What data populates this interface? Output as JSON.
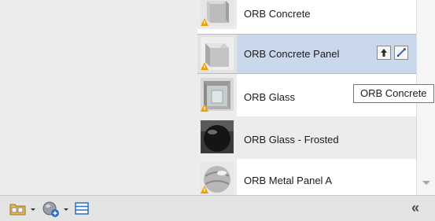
{
  "materials": [
    {
      "name": "ORB Concrete",
      "thumbnail": "concrete-cube-icon"
    },
    {
      "name": "ORB Concrete Panel",
      "thumbnail": "concrete-cube-icon"
    },
    {
      "name": "ORB Glass",
      "thumbnail": "glass-room-icon"
    },
    {
      "name": "ORB Glass - Frosted",
      "thumbnail": "frosted-glass-sphere-icon"
    },
    {
      "name": "ORB Metal Panel A",
      "thumbnail": "metal-sphere-icon"
    }
  ],
  "row_actions": [
    "move-up-icon",
    "edit-material-icon"
  ],
  "tooltip": "ORB Concrete",
  "toolbar": {
    "items": [
      "library-menu-icon",
      "add-library-menu-icon",
      "list-view-icon"
    ],
    "collapse_label": "«"
  },
  "colors": {
    "selected_row": "#cad8ec",
    "warning": "#f0a000",
    "accent": "#2b6cc4"
  }
}
